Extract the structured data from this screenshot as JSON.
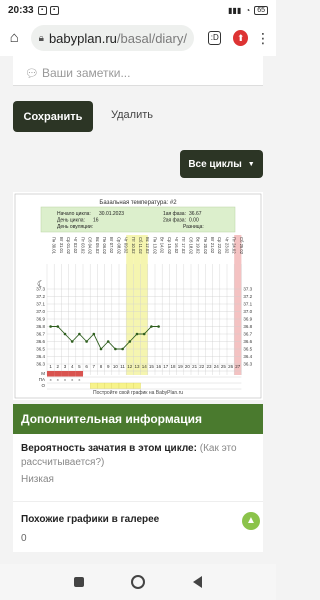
{
  "status": {
    "time": "20:33",
    "battery": "65"
  },
  "browser": {
    "host": "babyplan.ru",
    "path": "/basal/diary/",
    "tab_count": ":D"
  },
  "notes": {
    "placeholder": "Ваши заметки..."
  },
  "actions": {
    "save_label": "Сохранить",
    "delete_label": "Удалить",
    "cycles_label": "Все циклы"
  },
  "chart_data": {
    "type": "line",
    "title": "Базальная температура: #2",
    "cycle_info": {
      "start_label": "Начало цикла:",
      "start_value": "30.01.2023",
      "day_label": "День цикла:",
      "day_value": "16",
      "ovulation_label": "День овуляции:",
      "ovulation_value": "",
      "phase1_label": "1ая фаза:",
      "phase1_value": "36.67",
      "phase2_label": "2ая фаза:",
      "phase2_value": "0.00",
      "diff_label": "Разница:",
      "diff_value": ""
    },
    "dates": [
      "Пн 30.01",
      "Вт 31.01",
      "Ср 01.02",
      "Чт 02.02",
      "Пт 03.02",
      "Сб 04.02",
      "Вс 05.02",
      "Пн 06.02",
      "Вт 07.02",
      "Ср 08.02",
      "Чт 09.02",
      "Пт 10.02",
      "Сб 11.02",
      "Вс 12.02",
      "Пн 13.02",
      "Вт 14.02",
      "Ср 15.02",
      "Чт 16.02",
      "Пт 17.02",
      "Сб 18.02",
      "Вс 19.02",
      "Пн 20.02",
      "Вт 21.02",
      "Ср 22.02",
      "Чт 23.02",
      "Пт 24.02",
      "Сб 25.02"
    ],
    "y_ticks": [
      "37.3",
      "37.2",
      "37.1",
      "37.0",
      "36.9",
      "36.8",
      "36.7",
      "36.6",
      "36.5",
      "36.4",
      "36.3"
    ],
    "ylim": [
      36.3,
      37.3
    ],
    "days": [
      1,
      2,
      3,
      4,
      5,
      6,
      7,
      8,
      9,
      10,
      11,
      12,
      13,
      14,
      15,
      16,
      17,
      18,
      19,
      20,
      21,
      22,
      23,
      24,
      25,
      26,
      27
    ],
    "series": [
      {
        "values": [
          36.8,
          36.8,
          36.7,
          36.6,
          36.7,
          36.6,
          36.7,
          36.5,
          36.6,
          36.5,
          36.5,
          36.6,
          36.7,
          36.7,
          36.8,
          36.8
        ]
      }
    ],
    "highlight_days": [
      12,
      13,
      14
    ],
    "last_day": 27,
    "row_labels": [
      "М",
      "ПА",
      "О"
    ],
    "menstruation_days": [
      1,
      2,
      3,
      4,
      5
    ],
    "pa_marks": [
      {
        "day": 1,
        "mark": "x"
      },
      {
        "day": 2,
        "mark": "x"
      },
      {
        "day": 3,
        "mark": "x"
      },
      {
        "day": 4,
        "mark": "x"
      },
      {
        "day": 5,
        "mark": "x"
      }
    ],
    "ovulation_test_days": [
      7,
      8,
      9,
      10,
      11,
      12,
      13
    ],
    "footer": "Постройте свой график на BabyPlan.ru",
    "colors": {
      "line": "#2e5e1e",
      "highlight": "#f5f5b0",
      "last_day": "#f4c2c2",
      "menstruation": "#d9534f",
      "test": "#f7f38a"
    }
  },
  "info": {
    "header": "Дополнительная информация",
    "conception_label": "Вероятность зачатия в этом цикле:",
    "conception_help": "(Как это рассчитывается?)",
    "conception_value": "Низкая",
    "similar_label": "Похожие графики в галерее",
    "similar_count": "0"
  }
}
